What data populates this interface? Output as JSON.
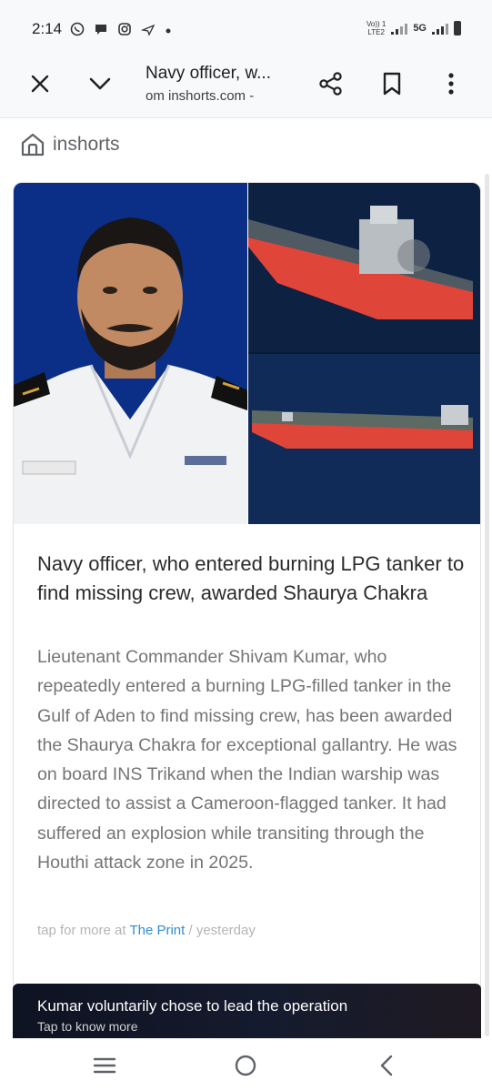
{
  "status_bar": {
    "time": "2:14",
    "network_label": "5G",
    "volte_label_top": "Vo)) 1",
    "volte_label_bottom": "LTE2"
  },
  "app_bar": {
    "title": "Navy officer, w...",
    "url": "om inshorts.com -"
  },
  "brand": {
    "name": "inshorts"
  },
  "article": {
    "headline": "Navy officer, who entered burning LPG tanker to find missing crew, awarded Shaurya Chakra",
    "summary": "Lieutenant Commander Shivam Kumar, who repeatedly entered a burning LPG-filled tanker in the Gulf of Aden to find missing crew, has been awarded the Shaurya Chakra for exceptional gallantry. He was on board INS Trikand when the Indian warship was directed to assist a Cameroon-flagged tanker. It had suffered an explosion while transiting through the Houthi attack zone in 2025.",
    "meta_prefix": "tap for more at",
    "source": "The Print",
    "meta_suffix": "/ yesterday"
  },
  "footer": {
    "title": "Kumar voluntarily chose to lead the operation",
    "subtitle": "Tap to know more"
  },
  "colors": {
    "link": "#2f8dd6",
    "tanker_red": "#e0453a",
    "uniform_bg": "#0b2f86"
  }
}
